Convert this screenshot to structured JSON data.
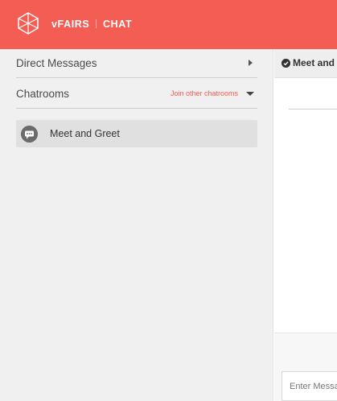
{
  "header": {
    "brand_name": "vFAIRS",
    "brand_section": "CHAT",
    "background_color": "#f35d54",
    "logo_icon": "cube-outline-icon"
  },
  "sidebar": {
    "direct_messages_label": "Direct Messages",
    "chatrooms_label": "Chatrooms",
    "join_other_label": "Join other chatrooms",
    "rooms": [
      {
        "label": "Meet and Greet",
        "icon": "chat-bubble-icon"
      }
    ]
  },
  "main": {
    "room_title": "Meet and Greet",
    "message_placeholder": "Enter Message"
  }
}
